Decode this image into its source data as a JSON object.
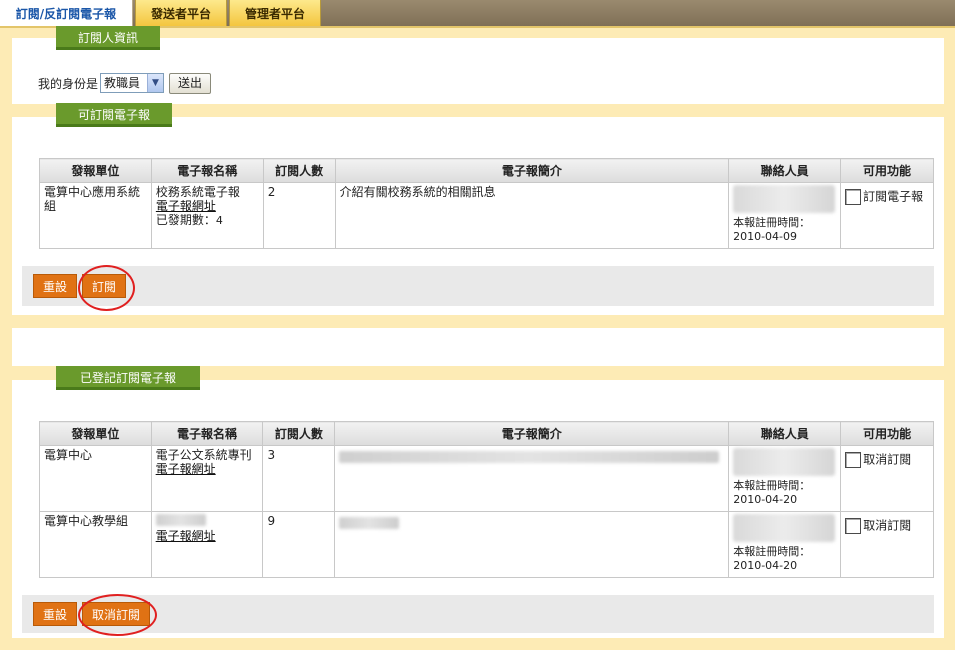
{
  "tabs": [
    {
      "label": "訂閱/反訂閱電子報",
      "active": true
    },
    {
      "label": "發送者平台",
      "active": false
    },
    {
      "label": "管理者平台",
      "active": false
    }
  ],
  "identity": {
    "section_title": "訂閱人資訊",
    "label": "我的身份是",
    "selected": "教職員",
    "submit_label": "送出"
  },
  "available": {
    "section_title": "可訂閱電子報",
    "headers": [
      "發報單位",
      "電子報名稱",
      "訂閱人數",
      "電子報簡介",
      "聯絡人員",
      "可用功能"
    ],
    "rows": [
      {
        "unit": "電算中心應用系統組",
        "name": "校務系統電子報",
        "url_label": "電子報網址",
        "issue_label": "已發期數：",
        "issue_count": "4",
        "subscribers": "2",
        "intro": "介紹有關校務系統的相關訊息",
        "reg_label": "本報註冊時間：",
        "reg_date": "2010-04-09",
        "action_label": "訂閱電子報"
      }
    ],
    "reset_label": "重設",
    "subscribe_label": "訂閱"
  },
  "registered": {
    "section_title": "已登記訂閱電子報",
    "headers": [
      "發報單位",
      "電子報名稱",
      "訂閱人數",
      "電子報簡介",
      "聯絡人員",
      "可用功能"
    ],
    "rows": [
      {
        "unit": "電算中心",
        "name": "電子公文系統專刊",
        "url_label": "電子報網址",
        "subscribers": "3",
        "reg_label": "本報註冊時間：",
        "reg_date": "2010-04-20",
        "action_label": "取消訂閱"
      },
      {
        "unit": "電算中心教學組",
        "url_label": "電子報網址",
        "subscribers": "9",
        "reg_label": "本報註冊時間：",
        "reg_date": "2010-04-20",
        "action_label": "取消訂閱"
      }
    ],
    "reset_label": "重設",
    "unsubscribe_label": "取消訂閱"
  },
  "colors": {
    "page_bg": "#fdebb5",
    "section_tag": "#6a9a2c",
    "action_button": "#e07214",
    "highlight_circle": "#e02020",
    "active_tab_text": "#1a56a8"
  }
}
